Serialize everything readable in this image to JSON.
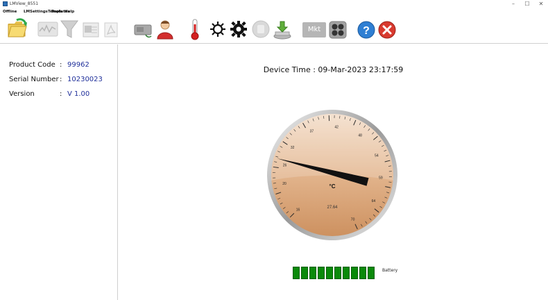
{
  "window": {
    "title": "LMView_8551",
    "minimize_glyph": "–",
    "maximize_glyph": "☐",
    "close_glyph": "✕"
  },
  "menu": {
    "items": [
      "Offline",
      "LMSettingsTemplates",
      "Tools",
      "Help"
    ]
  },
  "toolbar": {
    "mkt_label": "Mkt",
    "icons": [
      "open-folder-icon",
      "waveform-icon",
      "filter-icon",
      "excel-export-icon",
      "pdf-export-icon",
      "device-card-icon",
      "user-icon",
      "thermometer-icon",
      "gear-outline-icon",
      "gear-solid-icon",
      "stop-hand-icon",
      "download-icon",
      "mkt-icon",
      "grid-dots-icon",
      "help-icon",
      "exit-icon"
    ]
  },
  "device_info": {
    "product_code_label": "Product Code",
    "product_code_value": "99962",
    "serial_number_label": "Serial Number",
    "serial_number_value": "10230023",
    "version_label": "Version",
    "version_value": "V 1.00",
    "separator": ":"
  },
  "main": {
    "device_time": "Device Time : 09-Mar-2023 23:17:59"
  },
  "gauge": {
    "unit": "°C",
    "reading": "27.64",
    "scale_labels": [
      "16",
      "20",
      "26",
      "32",
      "37",
      "42",
      "48",
      "54",
      "59",
      "64",
      "70"
    ],
    "needle_value": 27.64,
    "face_color": "#d8a47a",
    "needle_color": "#111111"
  },
  "battery": {
    "label": "Battery",
    "segments": 10,
    "filled": 10,
    "color": "#0a8a0a"
  }
}
